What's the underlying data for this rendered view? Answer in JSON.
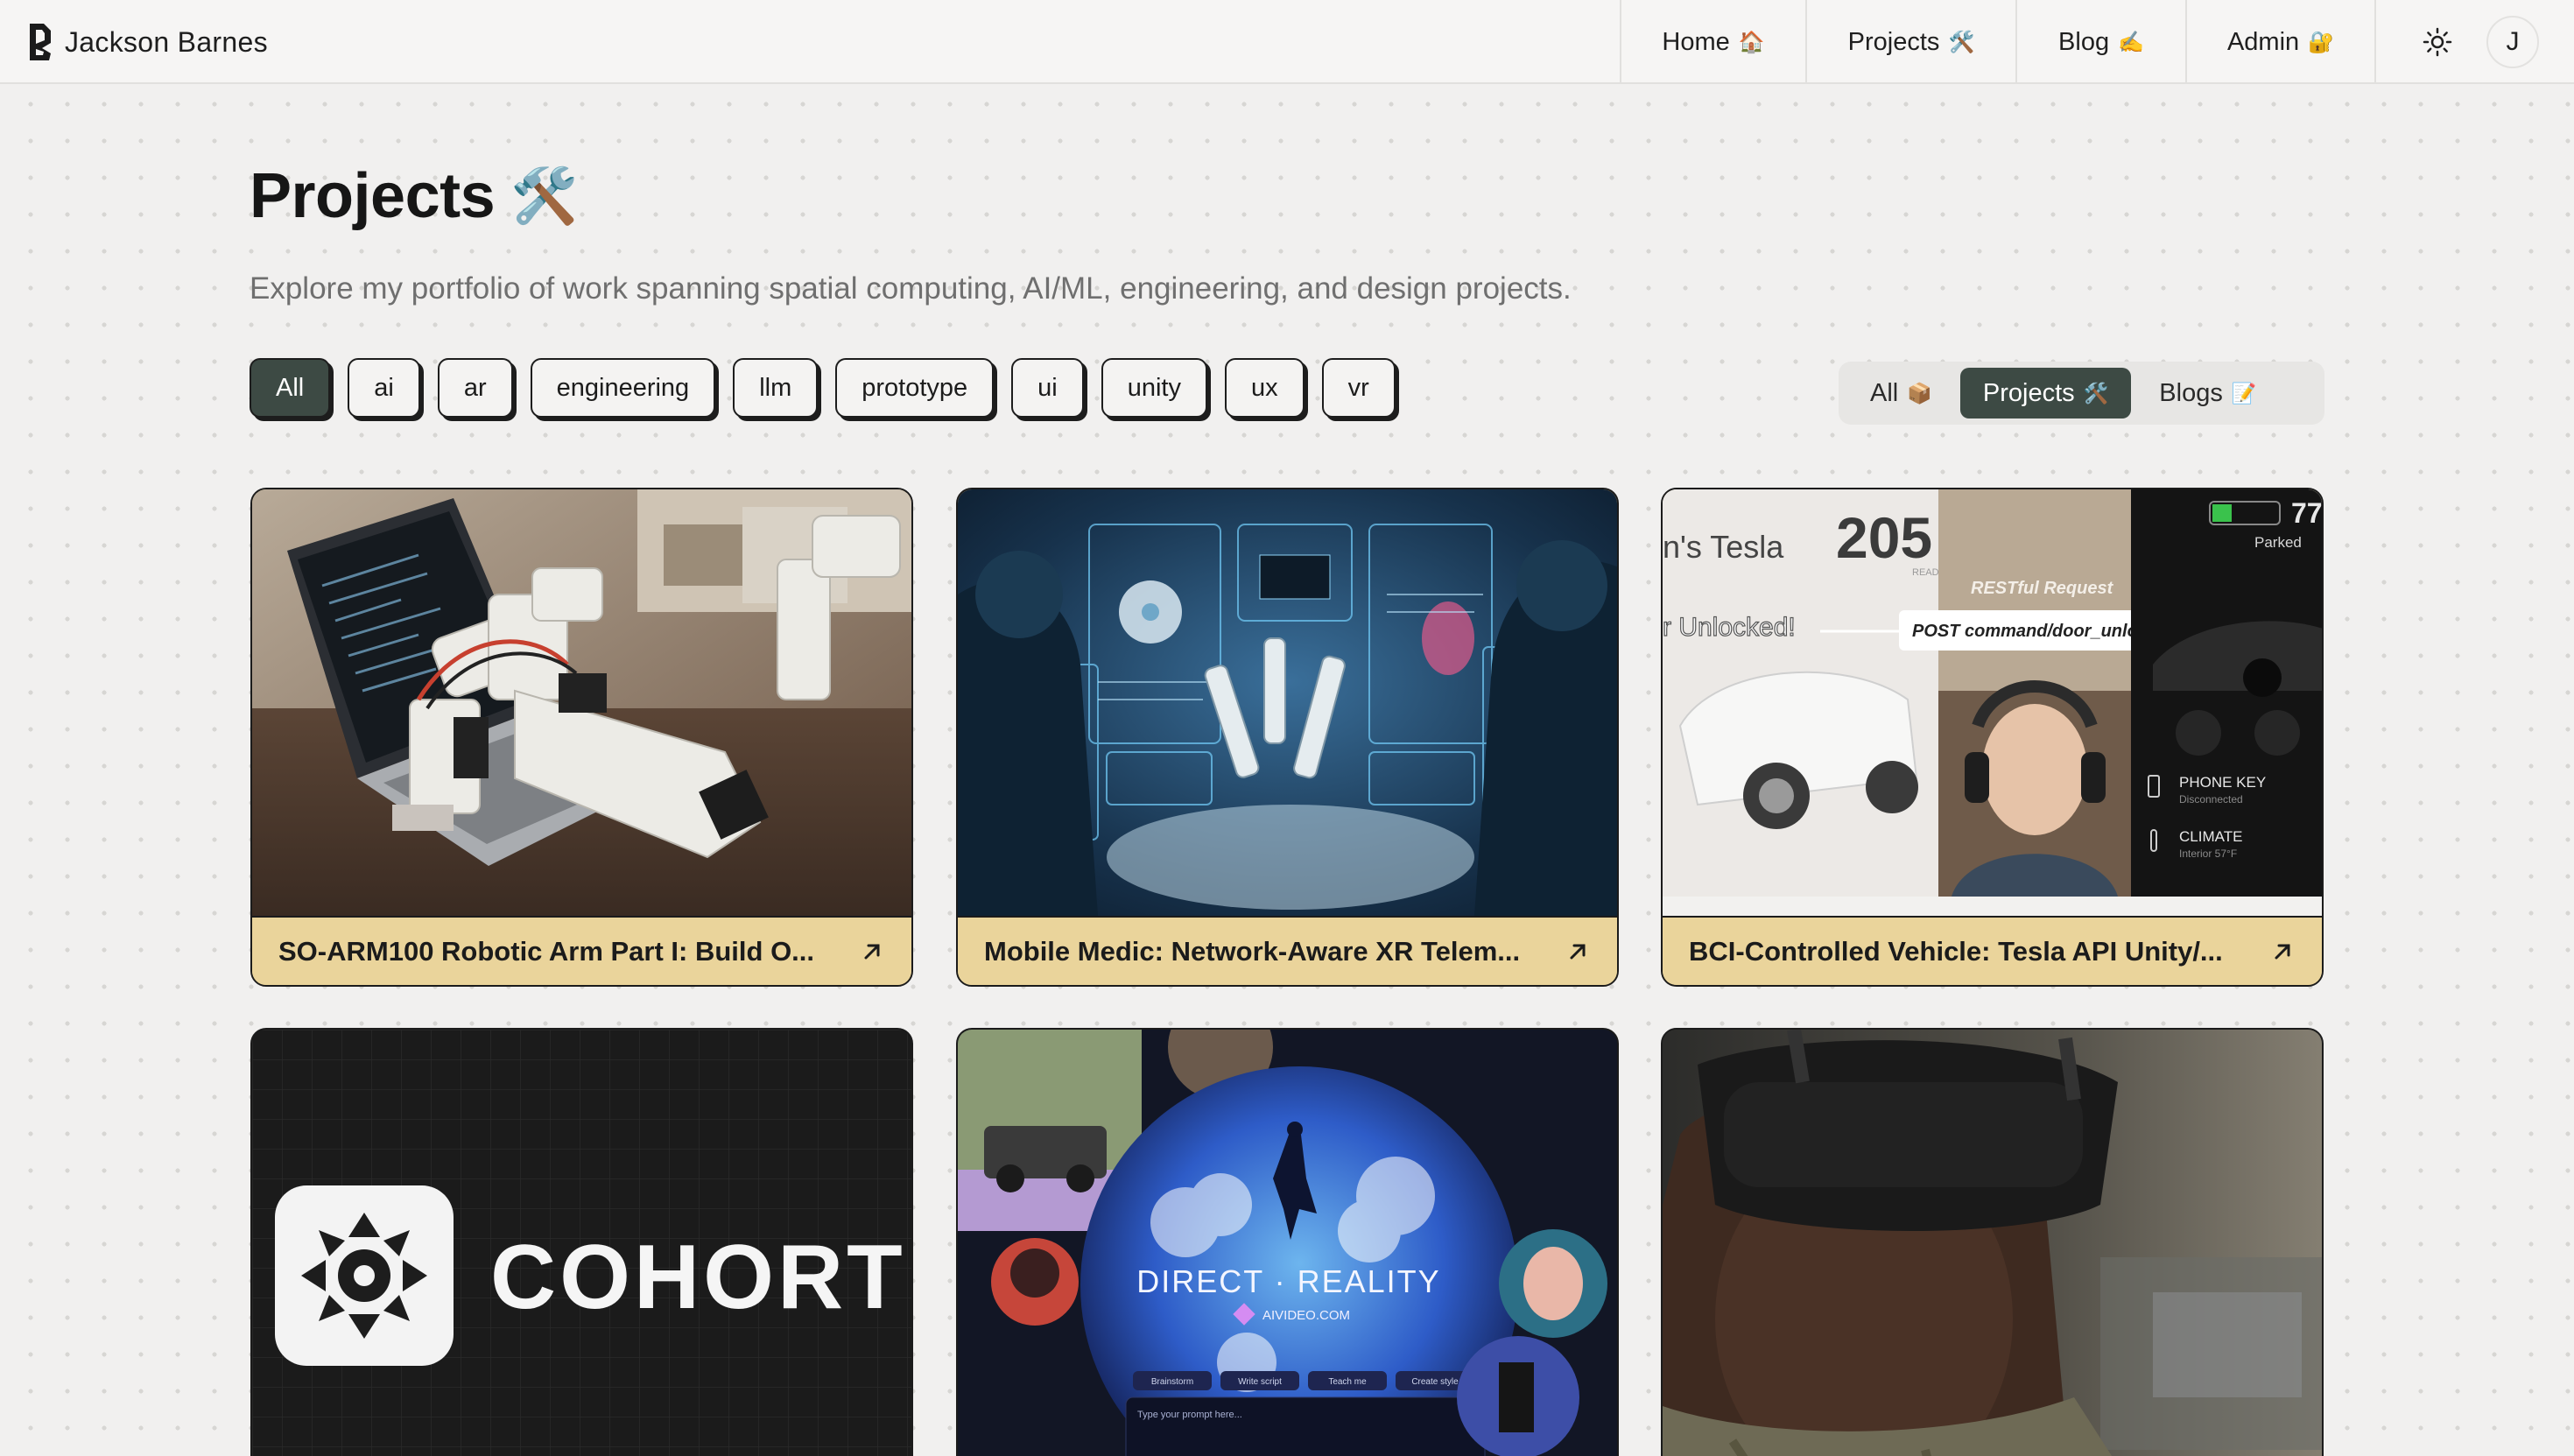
{
  "site": {
    "name": "Jackson Barnes",
    "avatar_initial": "J"
  },
  "nav": [
    {
      "label": "Home",
      "emoji": "🏠"
    },
    {
      "label": "Projects",
      "emoji": "🛠️"
    },
    {
      "label": "Blog",
      "emoji": "✍️"
    },
    {
      "label": "Admin",
      "emoji": "🔐"
    }
  ],
  "page": {
    "title": "Projects",
    "title_emoji": "🛠️",
    "subtitle": "Explore my portfolio of work spanning spatial computing, AI/ML, engineering, and design projects."
  },
  "tags": [
    "All",
    "ai",
    "ar",
    "engineering",
    "llm",
    "prototype",
    "ui",
    "unity",
    "ux",
    "vr"
  ],
  "active_tag": "All",
  "content_filter": [
    {
      "label": "All",
      "emoji": "📦"
    },
    {
      "label": "Projects",
      "emoji": "🛠️"
    },
    {
      "label": "Blogs",
      "emoji": "📝"
    }
  ],
  "active_filter": "Projects",
  "projects": [
    {
      "title": "SO-ARM100 Robotic Arm Part I: Build O...",
      "image": "robotic-arm-photo"
    },
    {
      "title": "Mobile Medic: Network-Aware XR Telem...",
      "image": "xr-surgery-illustration"
    },
    {
      "title": "BCI-Controlled Vehicle: Tesla API Unity/...",
      "image": "tesla-bci-collage"
    },
    {
      "title": "",
      "image": "cohort-logo-banner"
    },
    {
      "title": "",
      "image": "direct-reality-collage"
    },
    {
      "title": "",
      "image": "vr-headset-soldier-photo"
    }
  ],
  "thumbs": {
    "tesla": {
      "name_fragment": "n's Tesla",
      "reading": "205",
      "reading_sub": "READING",
      "range": "77",
      "status": "Parked",
      "restful": "RESTful Request",
      "command": "POST command/door_unlock",
      "unlocked": "r Unlocked!",
      "phone_key": "PHONE KEY",
      "phone_sub": "Disconnected",
      "climate": "CLIMATE",
      "climate_sub": "Interior 57°F"
    },
    "cohort": {
      "word": "COHORT"
    },
    "direct": {
      "title": "DIRECT · REALITY",
      "site": "AIVIDEO.COM",
      "chips": [
        "Brainstorm",
        "Write script",
        "Teach me",
        "Create style"
      ],
      "prompt": "Type your prompt here..."
    }
  }
}
